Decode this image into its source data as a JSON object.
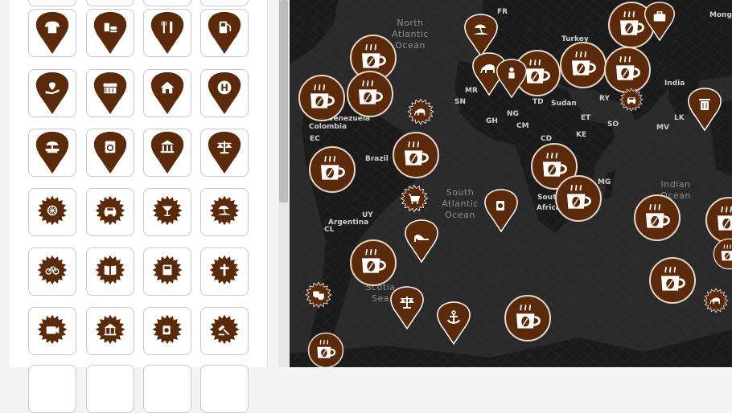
{
  "colors": {
    "marker_brown": "#5a2a0a",
    "marker_white": "#ffffff",
    "map_water": "#2a2a2a",
    "map_land": "#1a1a1a"
  },
  "sidebar": {
    "rows": [
      {
        "style": "pin",
        "icons": [
          "tshirt-icon",
          "fast-food-icon",
          "restaurant-icon",
          "fuel-icon"
        ]
      },
      {
        "style": "pin",
        "icons": [
          "plant-hand-icon",
          "market-stall-icon",
          "home-icon",
          "hospital-icon"
        ]
      },
      {
        "style": "pin",
        "icons": [
          "fountain-icon",
          "laundry-icon",
          "museum-icon",
          "justice-scale-icon"
        ]
      },
      {
        "style": "star",
        "icons": [
          "ferris-wheel-icon",
          "car-icon",
          "cocktail-icon",
          "beach-icon"
        ]
      },
      {
        "style": "star",
        "icons": [
          "bicycle-icon",
          "book-icon",
          "atm-icon",
          "church-cross-icon"
        ]
      },
      {
        "style": "star",
        "icons": [
          "camera-icon",
          "carousel-icon",
          "coffee-shop-icon",
          "auction-icon"
        ]
      }
    ]
  },
  "map": {
    "ocean_labels": [
      {
        "text": "North\nAtlantic\nOcean"
      },
      {
        "text": "South\nAtlantic\nOcean"
      },
      {
        "text": "Indian\nOcean"
      },
      {
        "text": "Scotia\nSea"
      }
    ],
    "country_labels": [
      "FR",
      "Turkey",
      "Mong",
      "MR",
      "TD",
      "Sudan",
      "RY",
      "India",
      "SN",
      "GH",
      "NG",
      "ET",
      "SO",
      "LK",
      "MV",
      "CM",
      "KE",
      "CD",
      "MG",
      "Venezuela",
      "Colombia",
      "EC",
      "Brazil",
      "Argentina",
      "UY",
      "CL",
      "South",
      "Africa"
    ],
    "markers": [
      "coffee-icon",
      "coffee-icon",
      "coffee-icon",
      "coffee-icon",
      "coffee-icon",
      "coffee-icon",
      "coffee-icon",
      "coffee-icon",
      "coffee-icon",
      "coffee-icon",
      "coffee-icon",
      "coffee-icon",
      "coffee-icon",
      "coffee-icon",
      "coffee-icon",
      "coffee-icon",
      "coffee-icon",
      "coffee-icon",
      "beach-icon",
      "elephant-icon",
      "person-icon",
      "briefcase-icon",
      "trash-icon",
      "elephant-icon",
      "cart-icon",
      "high-heel-icon",
      "justice-scale-icon",
      "anchor-icon",
      "theater-masks-icon",
      "theater-masks-icon",
      "car-icon",
      "coffee-shop-icon",
      "elephant-icon",
      "coffee-icon"
    ]
  }
}
